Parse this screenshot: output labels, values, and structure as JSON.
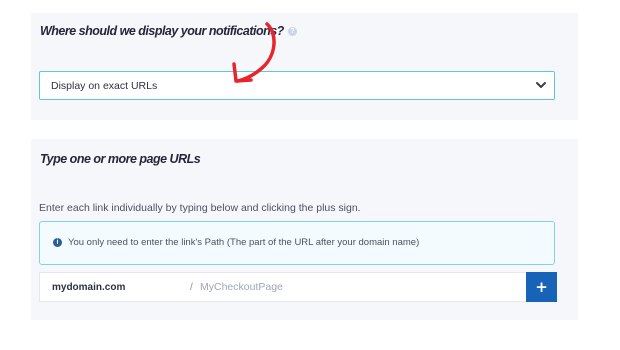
{
  "display_section": {
    "title": "Where should we display your notifications?",
    "help_icon": "question-circle-icon",
    "select": {
      "selected": "Display on exact URLs",
      "icon": "chevron-down-icon"
    },
    "annotation": {
      "shape": "curved-arrow",
      "color": "#e8242c"
    }
  },
  "urls_section": {
    "title": "Type one or more page URLs",
    "description": "Enter each link individually by typing below and clicking the plus sign.",
    "info": {
      "icon": "info-circle-icon",
      "text": "You only need to enter the link's Path (The part of the URL after your domain name)"
    },
    "url_row": {
      "domain": "mydomain.com",
      "separator": "/",
      "placeholder": "MyCheckoutPage",
      "add_button": "+"
    }
  },
  "colors": {
    "accent_border": "#5fc5e8",
    "primary_button": "#1763b8",
    "card_background": "#f6f7fb",
    "arrow": "#e8242c"
  }
}
